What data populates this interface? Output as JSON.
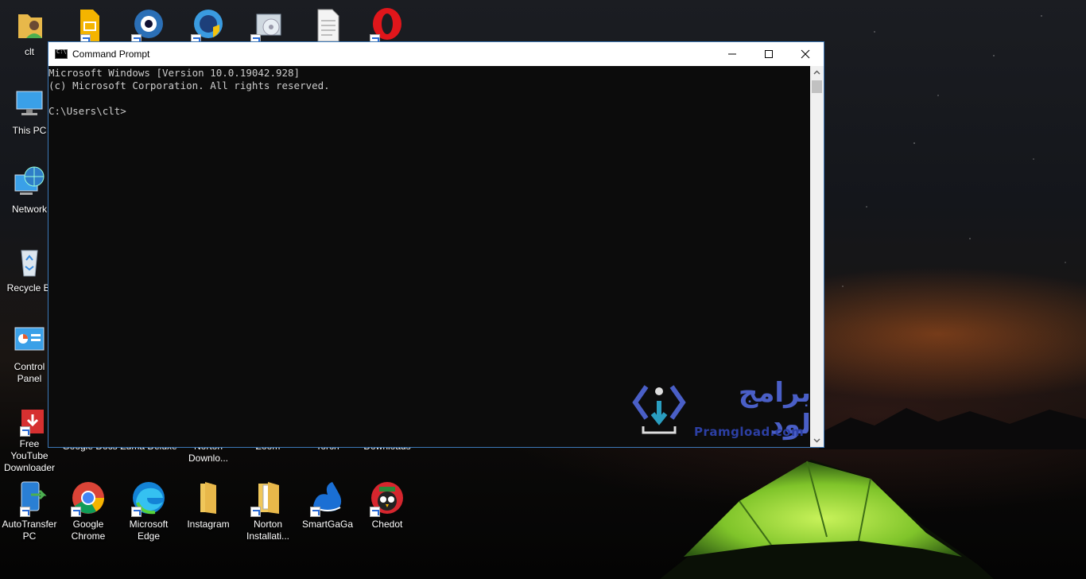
{
  "window": {
    "title": "Command Prompt",
    "controls": {
      "minimize": "minimize-icon",
      "maximize": "maximize-icon",
      "close": "close-icon"
    },
    "console_lines": [
      "Microsoft Windows [Version 10.0.19042.928]",
      "(c) Microsoft Corporation. All rights reserved.",
      "",
      "C:\\Users\\clt>"
    ]
  },
  "desktop": {
    "left_column": [
      {
        "label": "clt",
        "icon": "user-folder-icon"
      },
      {
        "label": "This PC",
        "icon": "computer-icon"
      },
      {
        "label": "Network",
        "icon": "network-icon"
      },
      {
        "label": "Recycle Bi",
        "icon": "recycle-bin-icon"
      },
      {
        "label": "Control\nPanel",
        "icon": "control-panel-icon"
      },
      {
        "label": "Free YouTube\nDownloader",
        "icon": "youtube-downloader-icon"
      },
      {
        "label": "AutoTransfer\nPC",
        "icon": "autotransfer-icon"
      }
    ],
    "top_row": [
      {
        "icon": "google-slides-icon"
      },
      {
        "icon": "webcam-icon"
      },
      {
        "icon": "shield-globe-icon"
      },
      {
        "icon": "dvd-software-icon"
      },
      {
        "icon": "document-icon"
      },
      {
        "icon": "opera-icon"
      }
    ],
    "partial_row_labels": [
      "Google Docs",
      "Zuma Deluxe",
      "Norton\nDownlo...",
      "Zoom",
      "Torch",
      "Downloads"
    ],
    "bottom_row": [
      {
        "label": "Google\nChrome",
        "icon": "chrome-icon"
      },
      {
        "label": "Microsoft\nEdge",
        "icon": "edge-icon"
      },
      {
        "label": "Instagram",
        "icon": "folder-icon"
      },
      {
        "label": "Norton\nInstallati...",
        "icon": "folder-docs-icon"
      },
      {
        "label": "SmartGaGa",
        "icon": "smartgaga-icon"
      },
      {
        "label": "Chedot",
        "icon": "chedot-icon"
      }
    ]
  },
  "watermark": {
    "arabic": "برامج لود",
    "latin": "Pramgload.com"
  },
  "colors": {
    "console_bg": "#0c0c0c",
    "console_text": "#cccccc",
    "watermark": "#4a5fc7",
    "window_border": "#3c78b8"
  }
}
